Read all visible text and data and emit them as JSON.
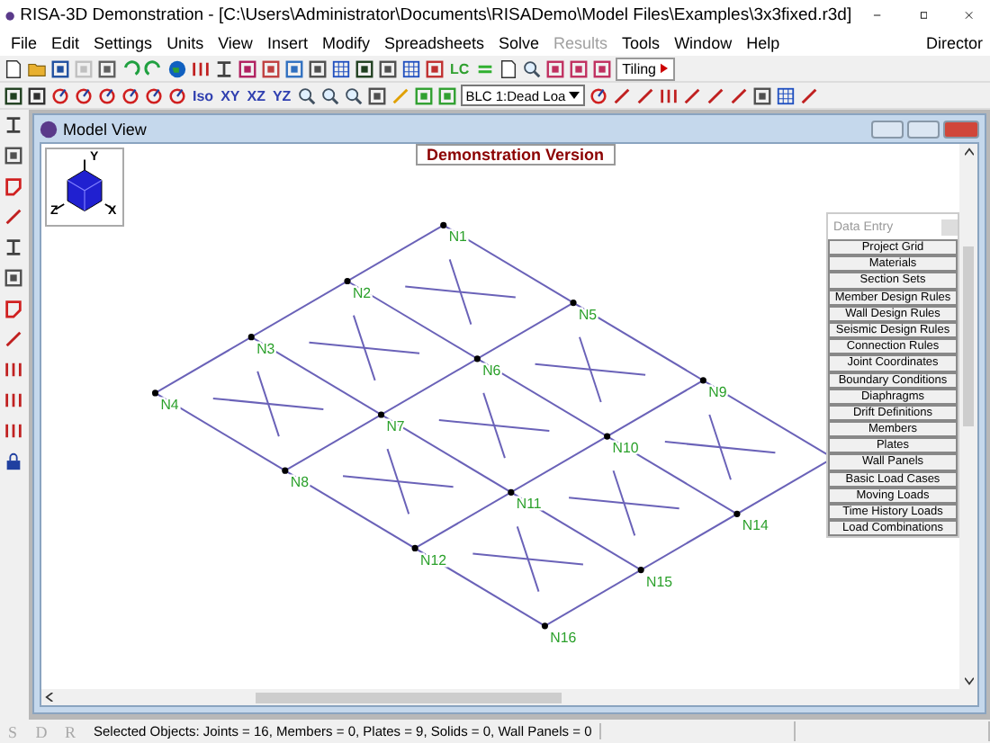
{
  "window": {
    "title": "RISA-3D Demonstration - [C:\\Users\\Administrator\\Documents\\RISADemo\\Model Files\\Examples\\3x3fixed.r3d]"
  },
  "menu": [
    {
      "label": "File",
      "disabled": false
    },
    {
      "label": "Edit",
      "disabled": false
    },
    {
      "label": "Settings",
      "disabled": false
    },
    {
      "label": "Units",
      "disabled": false
    },
    {
      "label": "View",
      "disabled": false
    },
    {
      "label": "Insert",
      "disabled": false
    },
    {
      "label": "Modify",
      "disabled": false
    },
    {
      "label": "Spreadsheets",
      "disabled": false
    },
    {
      "label": "Solve",
      "disabled": false
    },
    {
      "label": "Results",
      "disabled": true
    },
    {
      "label": "Tools",
      "disabled": false
    },
    {
      "label": "Window",
      "disabled": false
    },
    {
      "label": "Help",
      "disabled": false
    }
  ],
  "menu_right": "Director",
  "toolbar1": {
    "lc_label": "LC",
    "tiling_label": "Tiling"
  },
  "toolbar2": {
    "view_buttons": [
      "Iso",
      "XY",
      "XZ",
      "YZ"
    ],
    "load_case": {
      "value": "BLC 1:Dead Loa"
    }
  },
  "model_view": {
    "title": "Model View",
    "banner": "Demonstration Version",
    "axes": {
      "y": "Y",
      "z": "Z",
      "x": "X"
    },
    "nodes": [
      [
        "N1",
        "N2",
        "N3",
        "N4"
      ],
      [
        "N5",
        "N6",
        "N7",
        "N8"
      ],
      [
        "N9",
        "N10",
        "N11",
        "N12"
      ],
      [
        "N14",
        "N15",
        "N16"
      ]
    ],
    "data_entry": {
      "title": "Data Entry",
      "buttons": [
        "Project Grid",
        "Materials",
        "Section Sets",
        "Member Design Rules",
        "Wall Design Rules",
        "Seismic Design Rules",
        "Connection Rules",
        "Joint Coordinates",
        "Boundary Conditions",
        "Diaphragms",
        "Drift Definitions",
        "Members",
        "Plates",
        "Wall Panels",
        "Basic Load Cases",
        "Moving Loads",
        "Time History Loads",
        "Load Combinations"
      ]
    }
  },
  "status_bar": {
    "tabs": [
      {
        "label": "S",
        "disabled": true
      },
      {
        "label": "D",
        "disabled": true
      },
      {
        "label": "R",
        "disabled": true
      }
    ],
    "text": "Selected Objects:  Joints = 16,  Members = 0,  Plates = 9,  Solids = 0,  Wall Panels = 0"
  }
}
